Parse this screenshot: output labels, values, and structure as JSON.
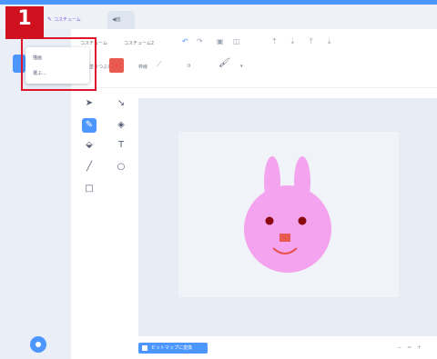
{
  "step": {
    "number": "1"
  },
  "tabs": [
    {
      "label": "コスチューム"
    },
    {
      "label": "音"
    }
  ],
  "toolbar": {
    "costume_name_label": "コスチューム",
    "costume_name_value": "コスチューム2",
    "fill_label": "塗りつぶし",
    "outline_label": "枠線",
    "outline_value": "0"
  },
  "dropdown": {
    "items": [
      {
        "label": "描画"
      },
      {
        "label": "選ぶ..."
      }
    ]
  },
  "footer": {
    "convert_button": "ビットマップに変換",
    "zoom": [
      "−",
      "=",
      "+"
    ]
  },
  "colors": {
    "accent": "#4c97ff",
    "fill": "#e85a4f",
    "bunny": "#f4a3ee",
    "highlight": "#e0142d"
  }
}
